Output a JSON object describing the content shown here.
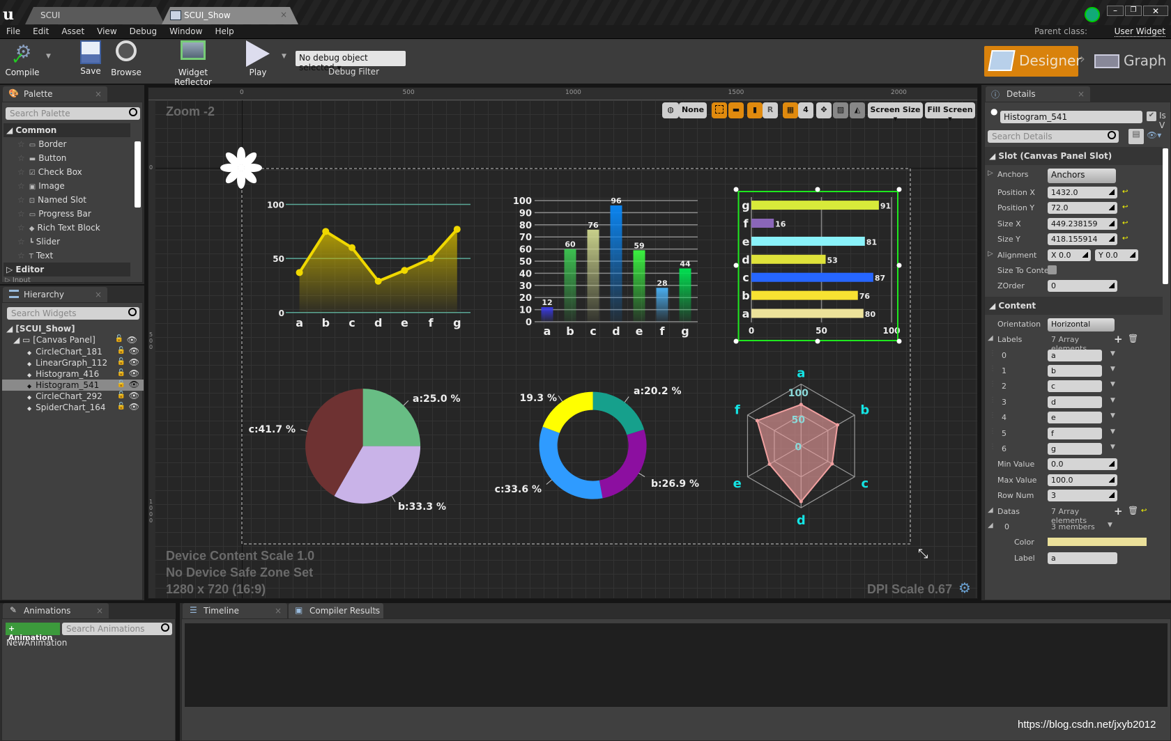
{
  "titlebar": {
    "tabs": [
      "SCUI",
      "SCUI_Show"
    ],
    "parent_class_label": "Parent class:",
    "parent_class_value": "User Widget"
  },
  "menu": [
    "File",
    "Edit",
    "Asset",
    "View",
    "Debug",
    "Window",
    "Help"
  ],
  "toolbar": {
    "compile": "Compile",
    "save": "Save",
    "browse": "Browse",
    "widget_reflector": "Widget Reflector",
    "play": "Play",
    "debug_object": "No debug object selected",
    "debug_filter": "Debug Filter",
    "designer": "Designer",
    "graph": "Graph"
  },
  "palette": {
    "title": "Palette",
    "search_placeholder": "Search Palette",
    "category": "Common",
    "items": [
      "Border",
      "Button",
      "Check Box",
      "Image",
      "Named Slot",
      "Progress Bar",
      "Rich Text Block",
      "Slider",
      "Text"
    ],
    "collapsed": [
      "Editor",
      "Input"
    ]
  },
  "hierarchy": {
    "title": "Hierarchy",
    "search_placeholder": "Search Widgets",
    "root": "[SCUI_Show]",
    "panel": "[Canvas Panel]",
    "items": [
      "CircleChart_181",
      "LinearGraph_112",
      "Histogram_416",
      "Histogram_541",
      "CircleChart_292",
      "SpiderChart_164"
    ],
    "selected": "Histogram_541"
  },
  "viewport": {
    "zoom": "Zoom -2",
    "ruler_x": [
      "0",
      "500",
      "1000",
      "1500",
      "2000"
    ],
    "ruler_y": [
      "0",
      "500",
      "1000"
    ],
    "none": "None",
    "r": "R",
    "grid_size": "4",
    "screen_size": "Screen Size",
    "fill_screen": "Fill Screen",
    "device_scale": "Device Content Scale 1.0",
    "safe_zone": "No Device Safe Zone Set",
    "resolution": "1280 x 720 (16:9)",
    "dpi": "DPI Scale 0.67"
  },
  "chart_data": [
    {
      "type": "area",
      "categories": [
        "a",
        "b",
        "c",
        "d",
        "e",
        "f",
        "g"
      ],
      "values": [
        37,
        75,
        60,
        29,
        39,
        50,
        77
      ],
      "ylim": [
        0,
        100
      ],
      "yticks": [
        "0",
        "50",
        "100"
      ],
      "color": "#f0d800"
    },
    {
      "type": "bar",
      "categories": [
        "a",
        "b",
        "c",
        "d",
        "e",
        "f",
        "g"
      ],
      "values": [
        12,
        60,
        76,
        96,
        59,
        28,
        44
      ],
      "ylim": [
        0,
        100
      ],
      "yticks": [
        "0",
        "10",
        "20",
        "30",
        "40",
        "50",
        "60",
        "70",
        "80",
        "90",
        "100"
      ],
      "colors": [
        "#3a3ae8",
        "#3cc050",
        "#c8d08a",
        "#0a84f0",
        "#3af040",
        "#4aaef0",
        "#00e050"
      ]
    },
    {
      "type": "bar",
      "orientation": "horizontal",
      "categories": [
        "a",
        "b",
        "c",
        "d",
        "e",
        "f",
        "g"
      ],
      "values": [
        80,
        76,
        87,
        53,
        81,
        16,
        91
      ],
      "xlim": [
        0,
        100
      ],
      "xticks": [
        "0",
        "50",
        "100"
      ],
      "colors": [
        "#ece29a",
        "#f8e232",
        "#2666ff",
        "#dfe23a",
        "#8af2fa",
        "#8a66b8",
        "#d8ea3a"
      ]
    },
    {
      "type": "pie",
      "labels": [
        "a:25.0 %",
        "b:33.3 %",
        "c:41.7 %"
      ],
      "values": [
        25.0,
        33.3,
        41.7
      ],
      "colors": [
        "#68bd84",
        "#c9b3e8",
        "#6e3232"
      ]
    },
    {
      "type": "pie",
      "donut": true,
      "labels": [
        "a:20.2 %",
        "b:26.9 %",
        "c:33.6 %",
        "19.3 %"
      ],
      "values": [
        20.2,
        26.9,
        33.6,
        19.3
      ],
      "colors": [
        "#16a08c",
        "#8c0fa0",
        "#2f9bff",
        "#ffff00"
      ]
    },
    {
      "type": "radar",
      "categories": [
        "a",
        "b",
        "c",
        "d",
        "e",
        "f"
      ],
      "values": [
        67,
        68,
        58,
        90,
        59,
        82
      ],
      "rlim": [
        0,
        100
      ],
      "rticks": [
        "0",
        "50",
        "100"
      ],
      "color": "#f0a0a0"
    }
  ],
  "details": {
    "title": "Details",
    "name": "Histogram_541",
    "is_variable": "Is V",
    "search_placeholder": "Search Details",
    "slot_header": "Slot (Canvas Panel Slot)",
    "anchors_label": "Anchors",
    "anchors_value": "Anchors",
    "position_x": {
      "label": "Position X",
      "value": "1432.0"
    },
    "position_y": {
      "label": "Position Y",
      "value": "72.0"
    },
    "size_x": {
      "label": "Size X",
      "value": "449.238159"
    },
    "size_y": {
      "label": "Size Y",
      "value": "418.155914"
    },
    "alignment": {
      "label": "Alignment",
      "x": "X  0.0",
      "y": "Y  0.0"
    },
    "size_to_content": "Size To Conte",
    "zorder": {
      "label": "ZOrder",
      "value": "0"
    },
    "content_header": "Content",
    "orientation": {
      "label": "Orientation",
      "value": "Horizontal"
    },
    "labels": {
      "label": "Labels",
      "count": "7 Array elements",
      "items": [
        {
          "i": "0",
          "v": "a"
        },
        {
          "i": "1",
          "v": "b"
        },
        {
          "i": "2",
          "v": "c"
        },
        {
          "i": "3",
          "v": "d"
        },
        {
          "i": "4",
          "v": "e"
        },
        {
          "i": "5",
          "v": "f"
        },
        {
          "i": "6",
          "v": "g"
        }
      ]
    },
    "min_value": {
      "label": "Min Value",
      "value": "0.0"
    },
    "max_value": {
      "label": "Max Value",
      "value": "100.0"
    },
    "row_num": {
      "label": "Row Num",
      "value": "3"
    },
    "datas": {
      "label": "Datas",
      "count": "7 Array elements",
      "index": "0",
      "members": "3 members",
      "color_label": "Color",
      "color_value": "#ebe09a",
      "label_label": "Label",
      "label_value": "a"
    }
  },
  "animations": {
    "title": "Animations",
    "add": "+ Animation",
    "search_placeholder": "Search Animations",
    "items": [
      "NewAnimation"
    ]
  },
  "bottom_tabs": [
    "Timeline",
    "Compiler Results"
  ],
  "watermark": "https://blog.csdn.net/jxyb2012"
}
